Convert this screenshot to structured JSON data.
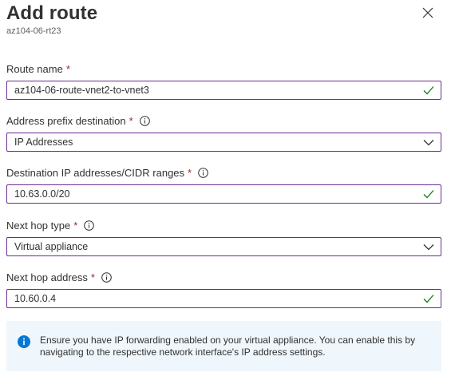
{
  "header": {
    "title": "Add route",
    "subtitle": "az104-06-rt23"
  },
  "fields": {
    "route_name": {
      "label": "Route name",
      "required": "*",
      "value": "az104-06-route-vnet2-to-vnet3"
    },
    "address_prefix_destination": {
      "label": "Address prefix destination",
      "required": "*",
      "value": "IP Addresses"
    },
    "destination_ranges": {
      "label": "Destination IP addresses/CIDR ranges",
      "required": "*",
      "value": "10.63.0.0/20"
    },
    "next_hop_type": {
      "label": "Next hop type",
      "required": "*",
      "value": "Virtual appliance"
    },
    "next_hop_address": {
      "label": "Next hop address",
      "required": "*",
      "value": "10.60.0.4"
    }
  },
  "notice": {
    "text": "Ensure you have IP forwarding enabled on your virtual appliance. You can enable this by navigating to the respective network interface's IP address settings."
  },
  "icons": {
    "close": "close-icon",
    "info": "info-icon",
    "check": "checkmark-icon",
    "dropdown": "chevron-down-icon",
    "notice": "info-filled-icon"
  },
  "colors": {
    "input_border": "#6b2c91",
    "required": "#a4262c",
    "check": "#107c10",
    "notice_bg": "#eff6fc",
    "notice_icon": "#0078d4"
  }
}
